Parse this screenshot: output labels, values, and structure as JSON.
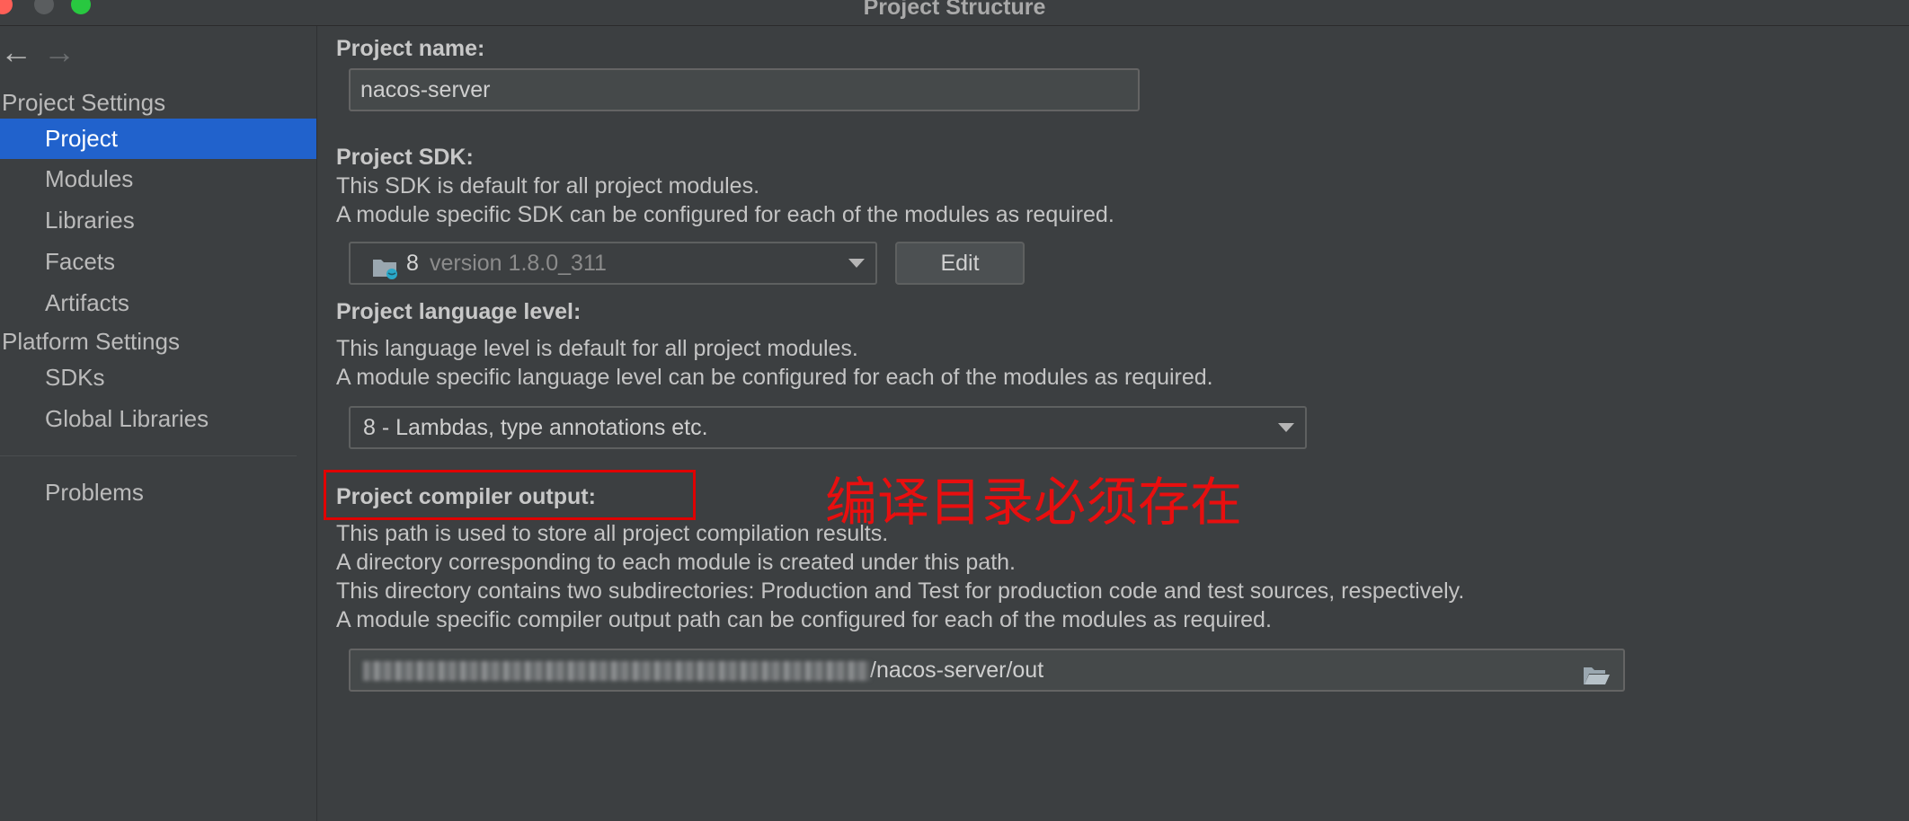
{
  "window": {
    "title": "Project Structure"
  },
  "sidebar": {
    "project_settings_header": "Project Settings",
    "platform_settings_header": "Platform Settings",
    "items": [
      {
        "label": "Project"
      },
      {
        "label": "Modules"
      },
      {
        "label": "Libraries"
      },
      {
        "label": "Facets"
      },
      {
        "label": "Artifacts"
      },
      {
        "label": "SDKs"
      },
      {
        "label": "Global Libraries"
      },
      {
        "label": "Problems"
      }
    ],
    "selected": "Project"
  },
  "main": {
    "project_name": {
      "label": "Project name:",
      "value": "nacos-server"
    },
    "project_sdk": {
      "label": "Project SDK:",
      "desc1": "This SDK is default for all project modules.",
      "desc2": "A module specific SDK can be configured for each of the modules as required.",
      "selected_name": "8",
      "selected_version": "version 1.8.0_311",
      "edit_label": "Edit"
    },
    "language_level": {
      "label": "Project language level:",
      "desc1": "This language level is default for all project modules.",
      "desc2": "A module specific language level can be configured for each of the modules as required.",
      "selected": "8 - Lambdas, type annotations etc."
    },
    "compiler_output": {
      "label": "Project compiler output:",
      "desc1": "This path is used to store all project compilation results.",
      "desc2": "A directory corresponding to each module is created under this path.",
      "desc3": "This directory contains two subdirectories: Production and Test for production code and test sources, respectively.",
      "desc4": "A module specific compiler output path can be configured for each of the modules as required.",
      "path_visible": "/nacos-server/out"
    },
    "annotation": "编译目录必须存在"
  },
  "colors": {
    "background": "#3c3f41",
    "selection": "#2162cc",
    "annotation_red": "#e00000"
  },
  "icons": [
    "back-arrow-icon",
    "forward-arrow-icon",
    "folder-java-icon",
    "chevron-down-icon",
    "folder-open-icon"
  ]
}
